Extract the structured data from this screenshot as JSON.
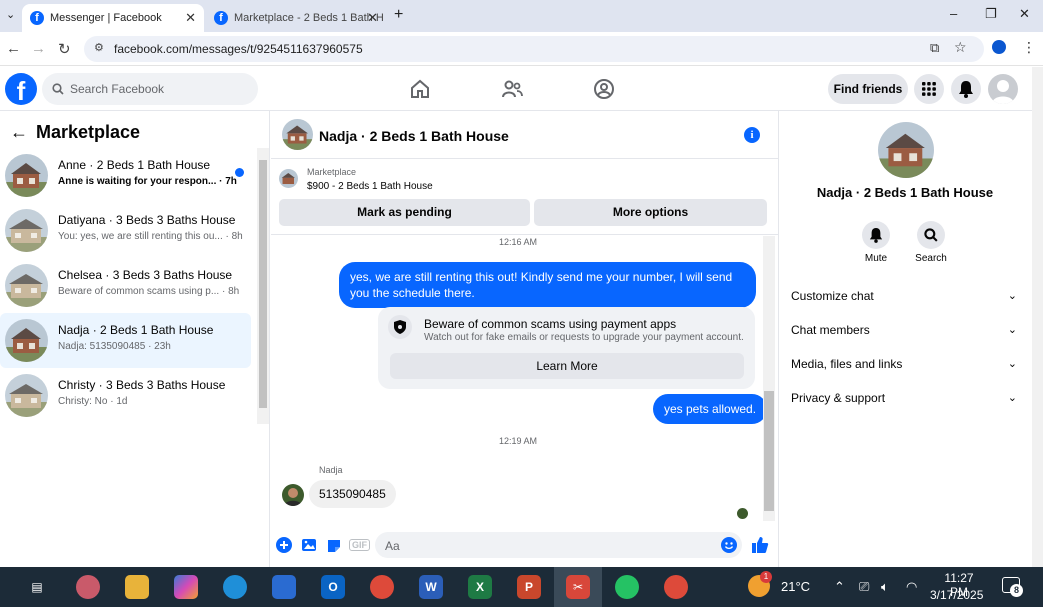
{
  "browser": {
    "tabs": [
      {
        "title": "Messenger | Facebook",
        "active": true
      },
      {
        "title": "Marketplace - 2 Beds 1 Bath H",
        "active": false
      }
    ],
    "new_tab": "+",
    "url": "facebook.com/messages/t/9254511637960575",
    "win_controls": {
      "minimize": "–",
      "restore": "❐",
      "close": "✕"
    }
  },
  "fb_header": {
    "logo": "f",
    "search_placeholder": "Search Facebook",
    "find_friends": "Find friends"
  },
  "left": {
    "title": "Marketplace",
    "chats": [
      {
        "name": "Anne · 2 Beds 1 Bath House",
        "preview": "Anne is waiting for your respon... · 7h",
        "unread": true,
        "selected": false
      },
      {
        "name": "Datiyana · 3 Beds 3 Baths House",
        "preview": "You: yes, we are still renting this ou... · 8h",
        "unread": false,
        "selected": false
      },
      {
        "name": "Chelsea · 3 Beds 3 Baths House",
        "preview": "Beware of common scams using p... · 8h",
        "unread": false,
        "selected": false
      },
      {
        "name": "Nadja · 2 Beds 1 Bath House",
        "preview": "Nadja: 5135090485 · 23h",
        "unread": false,
        "selected": true
      },
      {
        "name": "Christy · 3 Beds 3 Baths House",
        "preview": "Christy: No · 1d",
        "unread": false,
        "selected": false
      }
    ]
  },
  "conversation": {
    "title": "Nadja · 2 Beds 1 Bath House",
    "info_icon": "i",
    "marketplace_label": "Marketplace",
    "listing": "$900 - 2 Beds 1 Bath House",
    "mark_pending": "Mark as pending",
    "more_options": "More options",
    "time1": "12:16 AM",
    "msg_out_1": "yes, we are still renting this out! Kindly send me your number, I will send you the schedule there.",
    "warning_title": "Beware of common scams using payment apps",
    "warning_sub": "Watch out for fake emails or requests to upgrade your payment account.",
    "learn_more": "Learn More",
    "msg_out_2": "yes pets allowed.",
    "time2": "12:19 AM",
    "sender": "Nadja",
    "msg_in_1": "5135090485",
    "input_placeholder": "Aa",
    "gif_label": "GIF"
  },
  "right": {
    "name": "Nadja · 2 Beds 1 Bath House",
    "mute": "Mute",
    "search": "Search",
    "sections": [
      "Customize chat",
      "Chat members",
      "Media, files and links",
      "Privacy & support"
    ]
  },
  "taskbar": {
    "temperature": "21°C",
    "time": "11:27 PM",
    "date": "3/17/2025",
    "notification_count": "8",
    "weather_badge": "1"
  },
  "colors": {
    "fb_blue": "#0866ff",
    "taskbar": "#1c2b38"
  }
}
